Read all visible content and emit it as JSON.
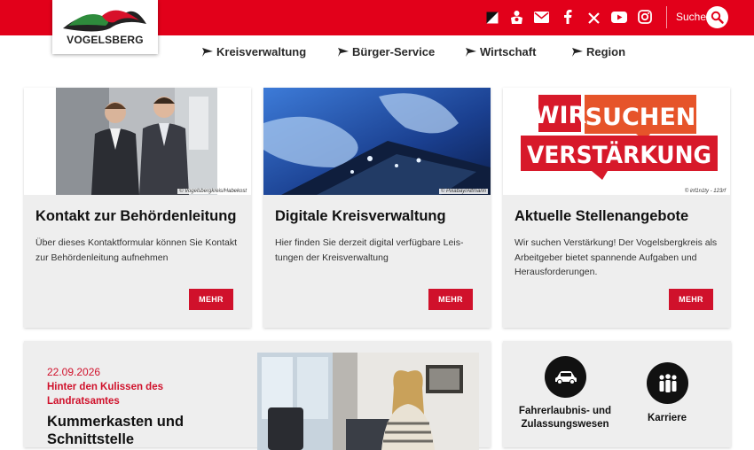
{
  "brand": {
    "logo_text": "VOGELSBERG",
    "accent": "#e2001a",
    "button": "#d0112b"
  },
  "header": {
    "icons": [
      "contrast-icon",
      "sign-language-icon",
      "mail-icon",
      "facebook-icon",
      "x-icon",
      "youtube-icon",
      "instagram-icon"
    ],
    "search_label": "Suche"
  },
  "nav": {
    "items": [
      {
        "label": "Kreisverwaltung"
      },
      {
        "label": "Bürger-Service"
      },
      {
        "label": "Wirtschaft"
      },
      {
        "label": "Region"
      }
    ]
  },
  "cards": [
    {
      "title": "Kontakt zur Behördenleitung",
      "text": "Über dieses Kontaktformular können Sie Kon­takt zur Behördenleitung aufnehmen",
      "credit": "© Vogelsbergkreis/Habekost",
      "button": "MEHR"
    },
    {
      "title": "Digitale Kreisverwaltung",
      "text": "Hier finden Sie derzeit digital verfügbare Leis­tungen der Kreisverwaltung",
      "credit": "© Pixabay/Altmann",
      "button": "MEHR"
    },
    {
      "title": "Aktuelle Stellenangebote",
      "text": "Wir suchen Verstärkung! Der Vogelsbergkreis als Arbeitgeber bietet spannende Aufgaben und Herausforderungen.",
      "credit": "© inf1n1ty - 123rf",
      "button": "MEHR",
      "banner": {
        "line1a": "WIR",
        "line1b": "SUCHEN",
        "line2": "VERSTÄRKUNG"
      }
    }
  ],
  "news": {
    "date": "22.09.2026",
    "kicker": "Hinter den Kulissen des Landratsamtes",
    "title": "Kummerkasten und Schnittstelle"
  },
  "services": [
    {
      "label": "Fahrerlaubnis- und Zulassungswesen",
      "icon": "car-icon"
    },
    {
      "label": "Karriere",
      "icon": "people-icon"
    }
  ]
}
